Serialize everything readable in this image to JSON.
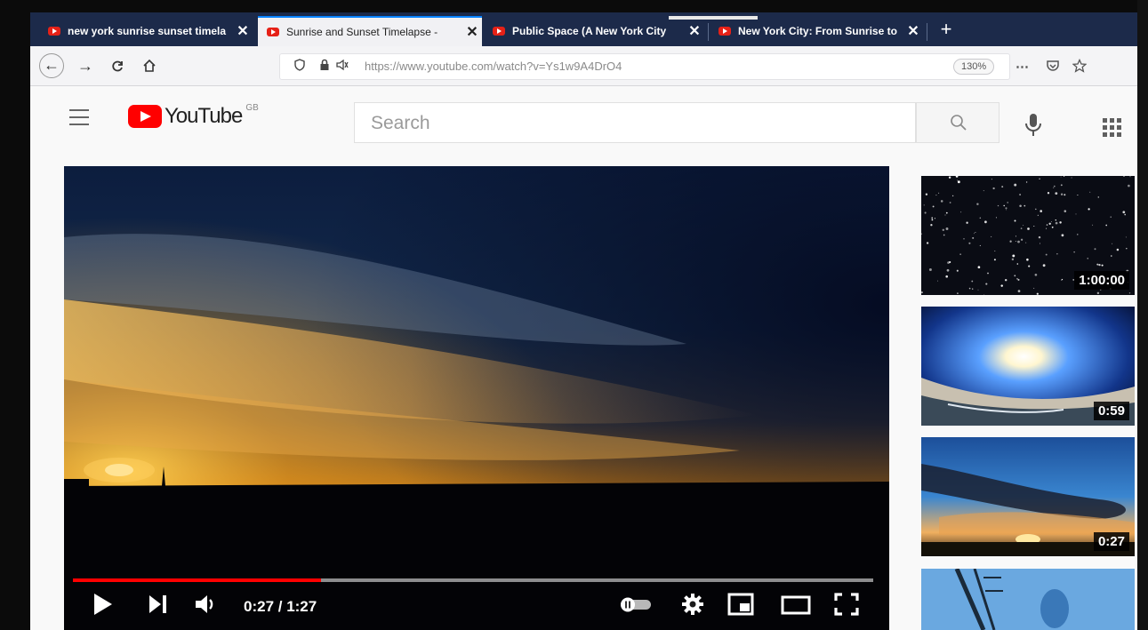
{
  "browser": {
    "tabs": [
      {
        "title": "new york sunrise sunset timela",
        "state": "inactive"
      },
      {
        "title": "Sunrise and Sunset Timelapse -",
        "state": "active"
      },
      {
        "title": "Public Space (A New York City",
        "state": "inactive"
      },
      {
        "title": "New York City: From Sunrise to",
        "state": "inactive"
      }
    ],
    "url": "https://www.youtube.com/watch?v=Ys1w9A4DrO4",
    "zoom": "130%",
    "more_menu": "⋯"
  },
  "youtube": {
    "logo_text": "YouTube",
    "region": "GB",
    "search_placeholder": "Search"
  },
  "player": {
    "time_display": "0:27 / 1:27",
    "progress_fraction": 0.31,
    "icons": [
      "play-icon",
      "next-icon",
      "volume-icon",
      "autoplay-toggle-icon",
      "settings-icon",
      "miniplayer-icon",
      "theater-mode-icon",
      "fullscreen-icon"
    ]
  },
  "recommendations": [
    {
      "duration": "1:00:00",
      "scene": "starfield"
    },
    {
      "duration": "0:59",
      "scene": "sun-fisheye"
    },
    {
      "duration": "0:27",
      "scene": "sunset-clouds"
    },
    {
      "duration": "",
      "scene": "crane-sky"
    }
  ],
  "colors": {
    "brand_red": "#ff0000",
    "tabstrip": "#1c2a4a",
    "progress": "#ff0000"
  }
}
